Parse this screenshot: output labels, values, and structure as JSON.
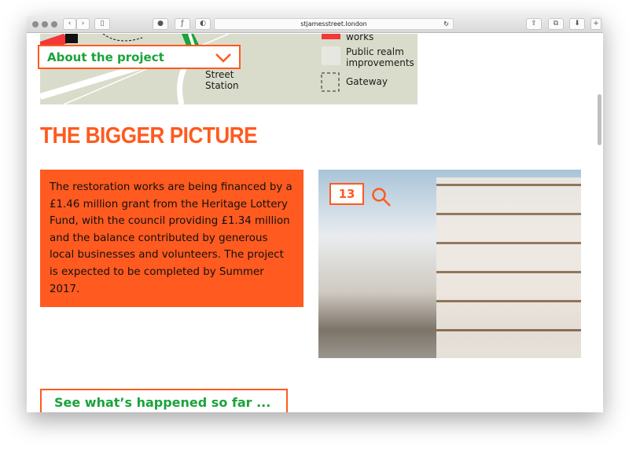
{
  "browser": {
    "url": "stjamesstreet.london"
  },
  "map": {
    "station_label_partial": "s",
    "station_label": "Street\nStation",
    "legend": [
      {
        "label": "works"
      },
      {
        "label": "Public realm\nimprovements"
      },
      {
        "label": "Gateway"
      }
    ]
  },
  "nav": {
    "about_label": "About the project"
  },
  "section": {
    "title": "THE BIGGER PICTURE",
    "body": "The restoration works are being financed by a £1.46 million grant from the Heritage Lottery Fund, with the council providing £1.34 million and the balance contributed by generous local businesses and volunteers. The project is expected to be completed by Summer 2017."
  },
  "gallery": {
    "count": "13"
  },
  "cta": {
    "label": "See what’s happened so far ..."
  },
  "colors": {
    "accent": "#ff5a1f",
    "green": "#1aa33b"
  }
}
